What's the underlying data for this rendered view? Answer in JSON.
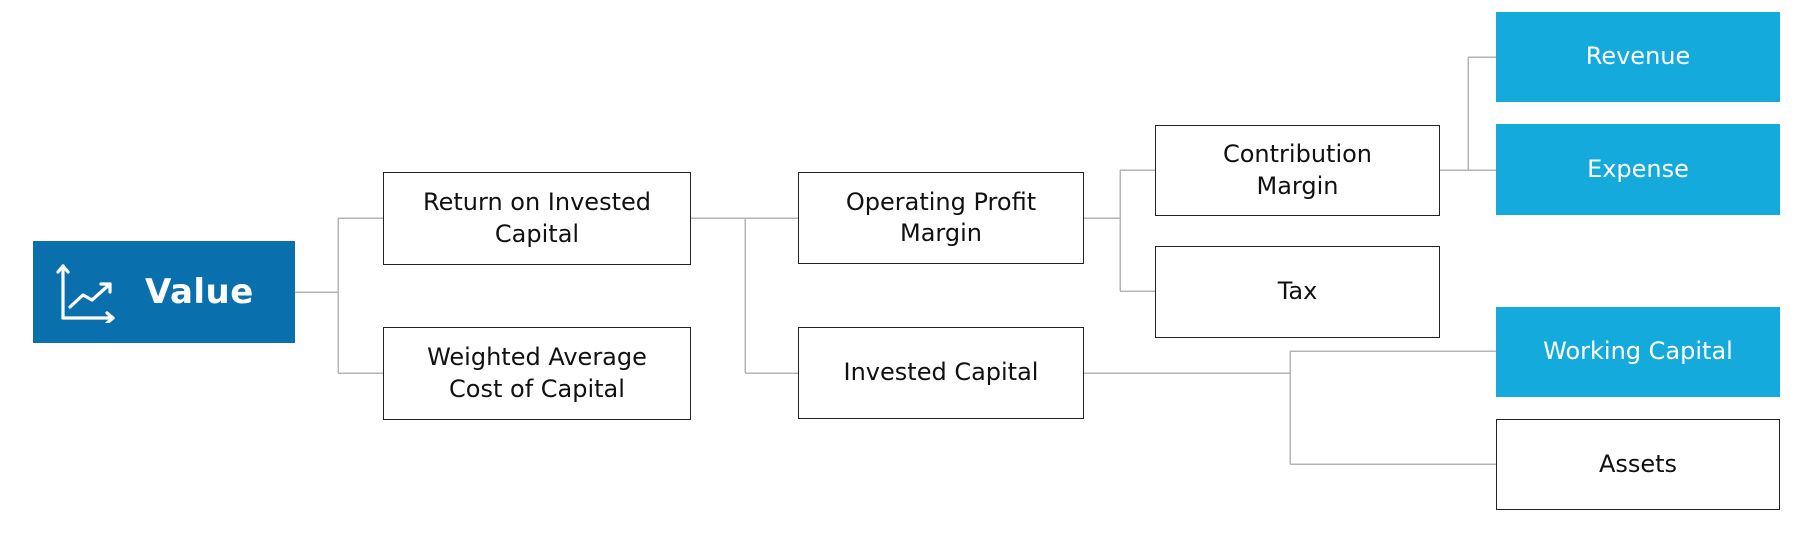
{
  "diagram": {
    "type": "value-driver-tree",
    "colors": {
      "root_fill": "#0a6fad",
      "leaf_highlight_fill": "#15aadc",
      "node_border": "#222222",
      "connector": "#b5b5b5",
      "text_dark": "#111111",
      "text_light": "#ffffff"
    },
    "root": {
      "label": "Value",
      "icon": "line-chart-growth-icon"
    },
    "nodes": {
      "roic": {
        "label": "Return on Invested\nCapital",
        "parent": "root"
      },
      "wacc": {
        "label": "Weighted Average\nCost of Capital",
        "parent": "root"
      },
      "opm": {
        "label": "Operating Profit\nMargin",
        "parent": "roic"
      },
      "ic": {
        "label": "Invested Capital",
        "parent": "roic"
      },
      "cm": {
        "label": "Contribution\nMargin",
        "parent": "opm"
      },
      "tax": {
        "label": "Tax",
        "parent": "opm"
      },
      "revenue": {
        "label": "Revenue",
        "parent": "cm",
        "highlighted": true
      },
      "expense": {
        "label": "Expense",
        "parent": "cm",
        "highlighted": true
      },
      "working_capital": {
        "label": "Working Capital",
        "parent": "ic",
        "highlighted": true
      },
      "assets": {
        "label": "Assets",
        "parent": "ic",
        "highlighted": false
      }
    }
  }
}
